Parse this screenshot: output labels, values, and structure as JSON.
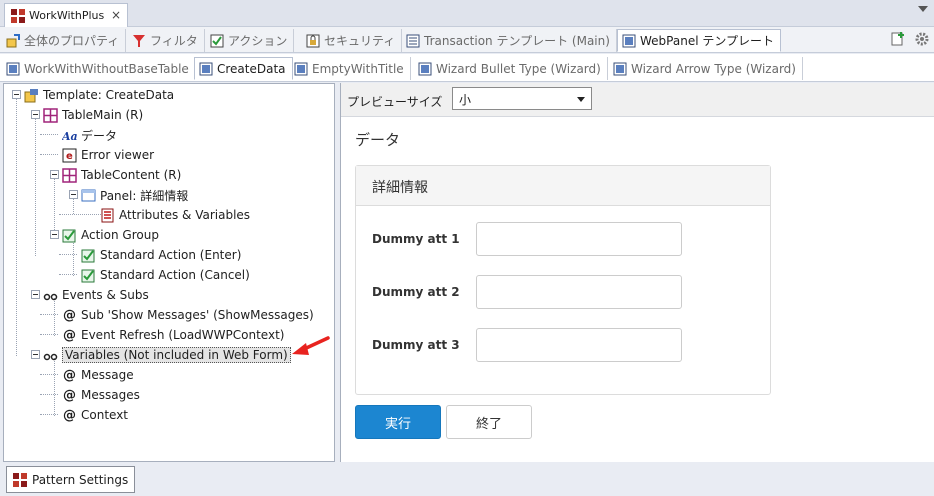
{
  "document_tab": {
    "title": "WorkWithPlus",
    "close": "×"
  },
  "pattern_tabs": [
    {
      "label": "全体のプロパティ",
      "icon": "properties-icon"
    },
    {
      "label": "フィルタ",
      "icon": "filter-icon"
    },
    {
      "label": "アクション",
      "icon": "action-icon"
    },
    {
      "label": "セキュリティ",
      "icon": "security-icon"
    },
    {
      "label": "Transaction テンプレート (Main)",
      "icon": "transaction-template-icon"
    },
    {
      "label": "WebPanel テンプレート",
      "icon": "webpanel-template-icon"
    }
  ],
  "template_tabs": [
    {
      "label": "WorkWithWithoutBaseTable"
    },
    {
      "label": "CreateData"
    },
    {
      "label": "EmptyWithTitle"
    },
    {
      "label": "Wizard Bullet Type (Wizard)"
    },
    {
      "label": "Wizard Arrow Type (Wizard)"
    }
  ],
  "tree": [
    {
      "label": "Template: CreateData",
      "icon": "template-icon"
    },
    {
      "label": "TableMain (R)",
      "icon": "table-icon"
    },
    {
      "label": "データ",
      "icon": "text-block-icon"
    },
    {
      "label": "Error viewer",
      "icon": "error-viewer-icon"
    },
    {
      "label": "TableContent (R)",
      "icon": "table-icon"
    },
    {
      "label": "Panel: 詳細情報",
      "icon": "panel-icon"
    },
    {
      "label": "Attributes & Variables",
      "icon": "attributes-icon"
    },
    {
      "label": "Action Group",
      "icon": "action-group-icon"
    },
    {
      "label": "Standard Action (Enter)",
      "icon": "action-icon"
    },
    {
      "label": "Standard Action (Cancel)",
      "icon": "action-icon"
    },
    {
      "label": "Events & Subs",
      "icon": "events-icon"
    },
    {
      "label": "Sub 'Show Messages' (ShowMessages)",
      "icon": "at-icon"
    },
    {
      "label": "Event Refresh (LoadWWPContext)",
      "icon": "at-icon"
    },
    {
      "label": "Variables (Not included in Web Form)",
      "icon": "events-icon"
    },
    {
      "label": "Message",
      "icon": "at-icon"
    },
    {
      "label": "Messages",
      "icon": "at-icon"
    },
    {
      "label": "Context",
      "icon": "at-icon"
    }
  ],
  "preview": {
    "size_label": "プレビューサイズ",
    "size_value": "小",
    "form_title": "データ",
    "panel_title": "詳細情報",
    "fields": [
      {
        "label": "Dummy att 1",
        "value": ""
      },
      {
        "label": "Dummy att 2",
        "value": ""
      },
      {
        "label": "Dummy att 3",
        "value": ""
      }
    ],
    "primary_button": "実行",
    "secondary_button": "終了"
  },
  "bottom": {
    "pattern_settings": "Pattern Settings"
  },
  "colors": {
    "accent": "#1c86d1",
    "arrow": "#e8231f",
    "brand": "#8b1a1a"
  }
}
